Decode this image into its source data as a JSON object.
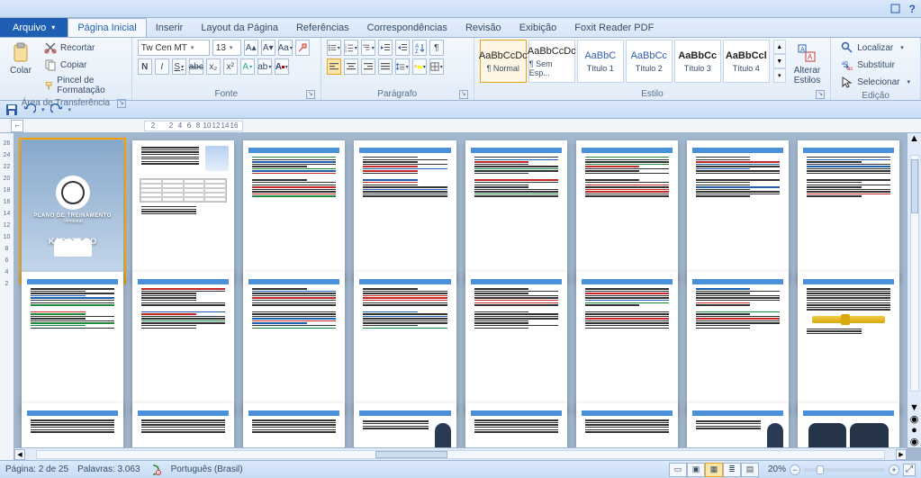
{
  "titlebar": {
    "help": "?",
    "help_tip": "Ajuda"
  },
  "tabs": {
    "file": "Arquivo",
    "items": [
      "Página Inicial",
      "Inserir",
      "Layout da Página",
      "Referências",
      "Correspondências",
      "Revisão",
      "Exibição",
      "Foxit Reader PDF"
    ],
    "active_index": 0
  },
  "qat": {
    "save_tip": "Salvar",
    "undo_tip": "Desfazer",
    "redo_tip": "Refazer"
  },
  "clipboard": {
    "group": "Área de Transferência",
    "paste": "Colar",
    "cut": "Recortar",
    "copy": "Copiar",
    "format_painter": "Pincel de Formatação"
  },
  "font": {
    "group": "Fonte",
    "name": "Tw Cen MT",
    "size": "13",
    "grow_tip": "Aumentar Fonte",
    "shrink_tip": "Diminuir Fonte",
    "case_tip": "Maiúsculas e Minúsculas",
    "clear_tip": "Limpar Formatação",
    "bold": "N",
    "italic": "I",
    "underline": "S",
    "strike": "abc",
    "sub": "x₂",
    "sup": "x²",
    "effects_tip": "Efeitos de Texto",
    "highlight_color": "#ffff00",
    "font_color": "#c00000"
  },
  "paragraph": {
    "group": "Parágrafo",
    "bullets_tip": "Marcadores",
    "numbers_tip": "Numeração",
    "multilevel_tip": "Lista Multinível",
    "dec_indent_tip": "Diminuir Recuo",
    "inc_indent_tip": "Aumentar Recuo",
    "sort_tip": "Classificar",
    "marks_tip": "Mostrar Tudo",
    "align_left": "Esquerda",
    "align_center": "Centralizar",
    "align_right": "Direita",
    "justify": "Justificar",
    "line_spacing_tip": "Espaçamento de Linha",
    "shading_tip": "Sombreamento",
    "borders_tip": "Bordas",
    "shading_color": "#ffff00"
  },
  "styles": {
    "group": "Estilo",
    "items": [
      {
        "preview": "AaBbCcDc",
        "name": "¶ Normal",
        "selected": true
      },
      {
        "preview": "AaBbCcDc",
        "name": "¶ Sem Esp..."
      },
      {
        "preview": "AaBbC",
        "name": "Título 1",
        "color": "#2a5db0"
      },
      {
        "preview": "AaBbCc",
        "name": "Título 2",
        "color": "#2a5db0"
      },
      {
        "preview": "AaBbCc",
        "name": "Título 3",
        "bold": true
      },
      {
        "preview": "AaBbCcl",
        "name": "Título 4",
        "bold": true
      }
    ],
    "change": "Alterar\nEstilos"
  },
  "editing": {
    "group": "Edição",
    "find": "Localizar",
    "replace": "Substituir",
    "select": "Selecionar"
  },
  "ruler": {
    "vmarks": [
      "26",
      "24",
      "22",
      "20",
      "18",
      "16",
      "14",
      "12",
      "10",
      "8",
      "6",
      "4",
      "2"
    ],
    "hmarks": [
      "2",
      "",
      "2",
      "4",
      "6",
      "8",
      "10",
      "12",
      "14",
      "16"
    ]
  },
  "cover": {
    "line1": "PLANO DE TREINAMENTO",
    "line2": "Trimestral",
    "big": "KARATE-DO"
  },
  "status": {
    "page": "Página: 2 de 25",
    "words": "Palavras: 3.063",
    "lang": "Português (Brasil)",
    "zoom": "20%",
    "view_tip": [
      "Layout de Impressão",
      "Leitura em Tela Inteira",
      "Layout da Web",
      "Estrutura de Tópicos",
      "Rascunho"
    ]
  }
}
